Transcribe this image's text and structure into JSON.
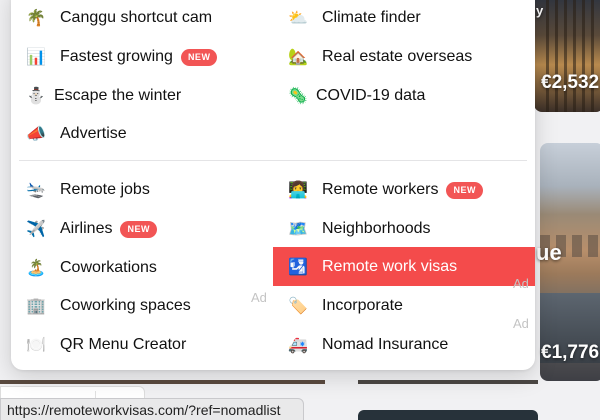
{
  "background": {
    "price_top": "€2,532",
    "price_bottom": "€1,776",
    "corner_top": "y",
    "corner_bottom": "ue"
  },
  "menu": {
    "top_left": [
      {
        "icon": "🌴",
        "label": "Canggu shortcut cam",
        "badge": ""
      },
      {
        "icon": "📊",
        "label": "Fastest growing",
        "badge": "NEW"
      },
      {
        "icon": "⛄",
        "label": "Escape the winter",
        "badge": ""
      },
      {
        "icon": "📣",
        "label": "Advertise",
        "badge": ""
      }
    ],
    "top_right": [
      {
        "icon": "⛅",
        "label": "Climate finder",
        "badge": ""
      },
      {
        "icon": "🏡",
        "label": "Real estate overseas",
        "badge": ""
      },
      {
        "icon": "🦠",
        "label": "COVID-19 data",
        "badge": ""
      }
    ],
    "bottom_left": [
      {
        "icon": "🛬",
        "label": "Remote jobs",
        "badge": ""
      },
      {
        "icon": "✈️",
        "label": "Airlines",
        "badge": "NEW"
      },
      {
        "icon": "🏝️",
        "label": "Coworkations",
        "badge": ""
      },
      {
        "icon": "🏢",
        "label": "Coworking spaces",
        "badge": ""
      },
      {
        "icon": "🍽️",
        "label": "QR Menu Creator",
        "badge": ""
      }
    ],
    "bottom_right": [
      {
        "icon": "👩‍💻",
        "label": "Remote workers",
        "badge": "NEW"
      },
      {
        "icon": "🗺️",
        "label": "Neighborhoods",
        "badge": ""
      },
      {
        "icon": "🛂",
        "label": "Remote work visas",
        "badge": ""
      },
      {
        "icon": "🏷️",
        "label": "Incorporate",
        "badge": ""
      },
      {
        "icon": "🚑",
        "label": "Nomad Insurance",
        "badge": ""
      }
    ],
    "ad_label": "Ad",
    "active_color": "#f44b4b",
    "badge_color": "#f25555"
  },
  "status_url": "https://remoteworkvisas.com/?ref=nomadlist"
}
